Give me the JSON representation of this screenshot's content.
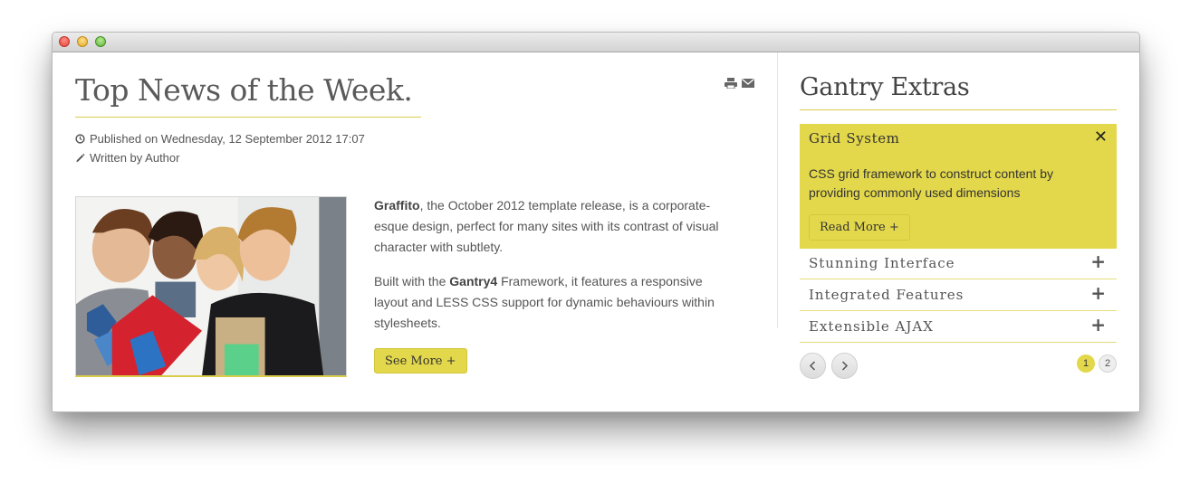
{
  "article": {
    "title": "Top News of the Week.",
    "published": "Published on Wednesday, 12 September 2012 17:07",
    "author": "Written by Author",
    "p1_bold": "Graffito",
    "p1_text": ", the October 2012 template release, is a corporate-esque design, perfect for many sites with its contrast of visual character with subtlety.",
    "p2_pre": "Built with the ",
    "p2_bold": "Gantry4",
    "p2_text": " Framework, it features a responsive layout and LESS CSS support for dynamic behaviours within stylesheets.",
    "see_more": "See More +"
  },
  "sidebar": {
    "title": "Gantry Extras",
    "open_item": {
      "title": "Grid System",
      "close": "✕",
      "description": "CSS grid framework to construct content by providing commonly used dimensions",
      "read_more": "Read More +"
    },
    "items": [
      {
        "label": "Stunning Interface",
        "icon": "+"
      },
      {
        "label": "Integrated Features",
        "icon": "+"
      },
      {
        "label": "Extensible AJAX",
        "icon": "+"
      }
    ],
    "pages": [
      "1",
      "2"
    ]
  },
  "colors": {
    "accent": "#e3d84b",
    "text": "#555555",
    "heading": "#5a5a5a"
  }
}
